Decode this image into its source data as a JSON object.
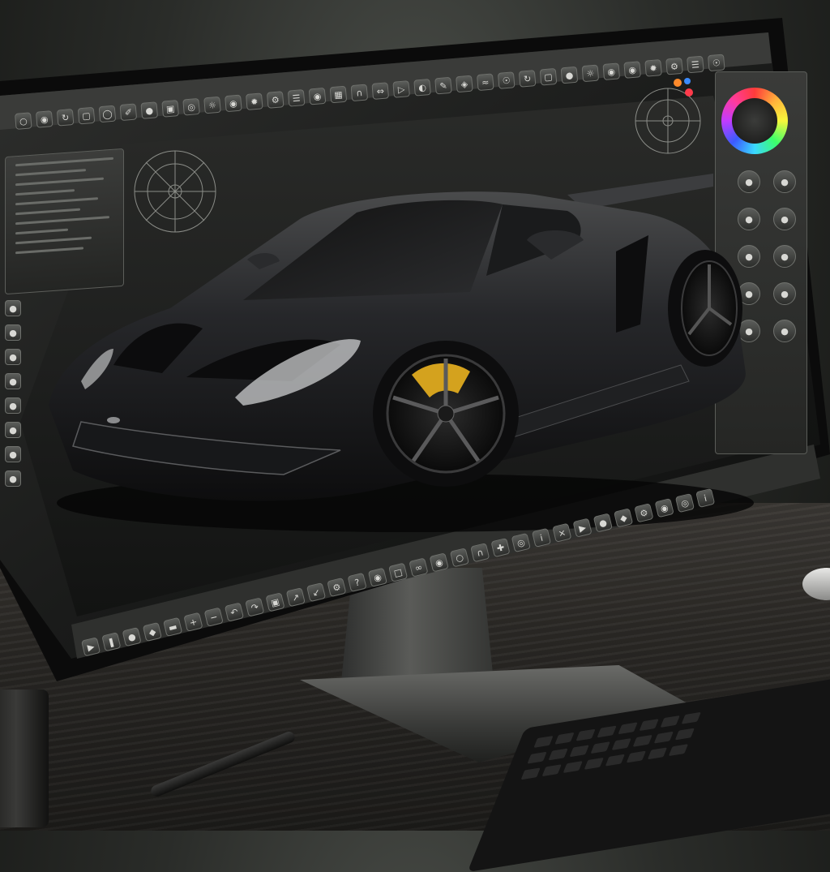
{
  "app": {
    "window_title": "",
    "top_menu": [],
    "status_text": ""
  },
  "colors": {
    "accent": "#f2c12e",
    "ui_dark": "#2b2c2a",
    "ui_border": "#6f716d",
    "car_body": "#1f2021",
    "brake_caliper": "#d4a21e"
  },
  "toolbar_top": {
    "icons": [
      "select-icon",
      "move-icon",
      "rotate-icon",
      "scale-icon",
      "lasso-icon",
      "brush-icon",
      "sphere-icon",
      "cube-icon",
      "torus-icon",
      "light-icon",
      "camera-icon",
      "wheel-icon",
      "gear-icon",
      "layers-icon",
      "eye-icon",
      "grid-icon",
      "magnet-icon",
      "mirror-icon",
      "render-icon",
      "material-icon",
      "paint-icon",
      "sculpt-icon",
      "curve-icon",
      "node-icon"
    ]
  },
  "toolbar_bottom": {
    "icons": [
      "play-icon",
      "pause-icon",
      "record-icon",
      "keyframe-icon",
      "timeline-icon",
      "zoom-in-icon",
      "zoom-out-icon",
      "undo-icon",
      "redo-icon",
      "save-icon",
      "export-icon",
      "import-icon",
      "settings-icon",
      "help-icon",
      "view-icon",
      "lock-icon",
      "link-icon",
      "visible-icon",
      "hidden-icon",
      "snap-icon",
      "axis-icon",
      "target-icon",
      "info-icon",
      "close-icon"
    ]
  },
  "toolbar_left": {
    "icons": [
      "circle-icon",
      "circle-icon",
      "circle-icon",
      "circle-icon",
      "circle-icon",
      "circle-icon",
      "circle-icon",
      "circle-icon"
    ]
  },
  "toolbar_right": {
    "icons": [
      "circle-icon",
      "circle-icon",
      "circle-icon",
      "circle-icon",
      "circle-icon",
      "circle-icon",
      "circle-icon",
      "circle-icon",
      "circle-icon",
      "circle-icon"
    ]
  },
  "left_panel": {
    "rows": 10
  },
  "viewport": {
    "subject": "sports-car-3d-model"
  }
}
